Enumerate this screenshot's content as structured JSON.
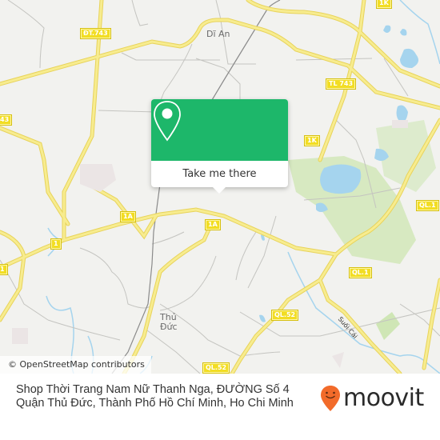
{
  "map": {
    "place_labels": [
      {
        "name": "di-an",
        "text": "Dĩ An"
      },
      {
        "name": "thu-duc-line1",
        "text": "Thủ"
      },
      {
        "name": "thu-duc-line2",
        "text": "Đức"
      }
    ],
    "route_shields": [
      "ĐT.743",
      "TL 743",
      "1K",
      "1K",
      "43",
      "1A",
      "1A",
      "1",
      "1",
      "QL.1",
      "QL.1",
      "QL.52",
      "QL.52"
    ],
    "water_labels": [
      "Suối Cái"
    ],
    "colors": {
      "land": "#f2f2ef",
      "major_road": "#f5e46b",
      "minor_road": "#c4c4c0",
      "water": "#a5d4ee",
      "park": "#cfe6b5",
      "shield": "#f2dd23"
    }
  },
  "popup": {
    "icon": "map-pin-icon",
    "button_label": "Take me there",
    "color": "#1db76a"
  },
  "attribution": "© OpenStreetMap contributors",
  "footer": {
    "address_line1": "Shop Thời Trang Nam Nữ Thanh Nga, ĐƯỜNG Số 4",
    "address_line2": "Quận Thủ Đức, Thành Phố Hồ Chí Minh, Ho Chi Minh",
    "brand": "moovit",
    "brand_color": "#f26b2a"
  }
}
